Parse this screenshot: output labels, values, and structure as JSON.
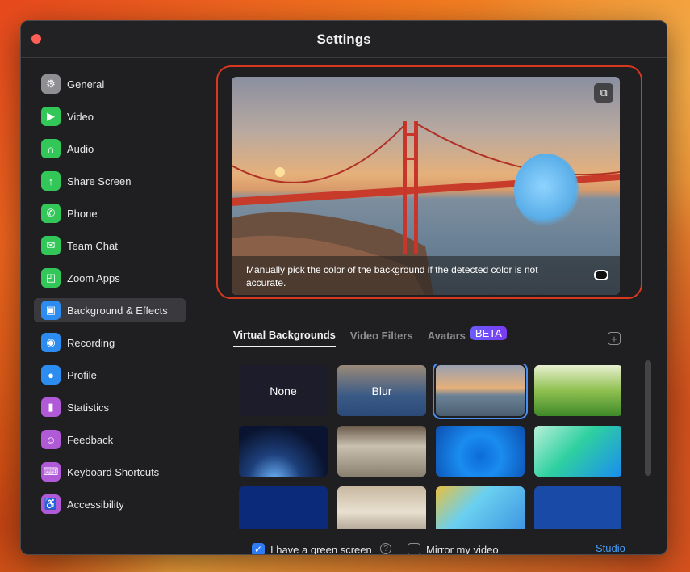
{
  "window": {
    "title": "Settings"
  },
  "sidebar": {
    "items": [
      {
        "label": "General",
        "icon": "gear-icon",
        "color": "#8e8e93",
        "glyph": "⚙"
      },
      {
        "label": "Video",
        "icon": "video-camera-icon",
        "color": "#33c759",
        "glyph": "▶"
      },
      {
        "label": "Audio",
        "icon": "headphones-icon",
        "color": "#33c759",
        "glyph": "∩"
      },
      {
        "label": "Share Screen",
        "icon": "share-screen-icon",
        "color": "#33c759",
        "glyph": "↑"
      },
      {
        "label": "Phone",
        "icon": "phone-icon",
        "color": "#33c759",
        "glyph": "✆"
      },
      {
        "label": "Team Chat",
        "icon": "chat-icon",
        "color": "#33c759",
        "glyph": "✉"
      },
      {
        "label": "Zoom Apps",
        "icon": "apps-icon",
        "color": "#33c759",
        "glyph": "◰"
      },
      {
        "label": "Background & Effects",
        "icon": "portrait-icon",
        "color": "#2d8cf0",
        "glyph": "▣",
        "active": true
      },
      {
        "label": "Recording",
        "icon": "record-icon",
        "color": "#2d8cf0",
        "glyph": "◉"
      },
      {
        "label": "Profile",
        "icon": "profile-icon",
        "color": "#2d8cf0",
        "glyph": "●"
      },
      {
        "label": "Statistics",
        "icon": "bar-chart-icon",
        "color": "#b05ad8",
        "glyph": "▮"
      },
      {
        "label": "Feedback",
        "icon": "smiley-icon",
        "color": "#b05ad8",
        "glyph": "☺"
      },
      {
        "label": "Keyboard Shortcuts",
        "icon": "keyboard-icon",
        "color": "#b05ad8",
        "glyph": "⌨"
      },
      {
        "label": "Accessibility",
        "icon": "accessibility-icon",
        "color": "#b05ad8",
        "glyph": "♿"
      }
    ]
  },
  "preview": {
    "caption": "Manually pick the color of the background if the detected color is not accurate."
  },
  "tabs": [
    {
      "label": "Virtual Backgrounds",
      "active": true
    },
    {
      "label": "Video Filters",
      "active": false
    },
    {
      "label": "Avatars",
      "active": false
    }
  ],
  "beta_badge": "BETA",
  "backgrounds": [
    {
      "label": "None",
      "bg": "#1c1c2a"
    },
    {
      "label": "Blur",
      "bg": "linear-gradient(180deg,#9a8a78 0%,#3a5a86 60%,#2b4a78 100%)"
    },
    {
      "label": "",
      "bg": "linear-gradient(180deg,#9aa0b0 0%,#e6b07a 45%,#6b8296 60%,#4a5e70 100%)",
      "selected": true
    },
    {
      "label": "",
      "bg": "linear-gradient(180deg,#e8f0d0 0%,#8fc050 50%,#3f8a2a 100%)"
    },
    {
      "label": "",
      "bg": "radial-gradient(ellipse at 40% 110%,#6fb8ff 0%,#1d3f7a 35%,#0a1430 70%)"
    },
    {
      "label": "",
      "bg": "linear-gradient(180deg,#6a5a4a 0%,#c9c0b0 40%,#8a8070 100%)"
    },
    {
      "label": "",
      "bg": "radial-gradient(circle at 50% 60%,#0c6cd8 0%,#1a8cf0 40%,#0b4fb0 100%)"
    },
    {
      "label": "",
      "bg": "linear-gradient(135deg,#b8f0d8 0%,#2fd0a0 45%,#1a8cf0 100%)"
    },
    {
      "label": "",
      "bg": "linear-gradient(180deg,#0b2a7a 0%,#0b2a7a 100%)"
    },
    {
      "label": "",
      "bg": "linear-gradient(180deg,#c8b8a0 0%,#e8e0d0 50%,#a09080 100%)"
    },
    {
      "label": "",
      "bg": "linear-gradient(135deg,#e8c040 0%,#6ad0f0 40%,#3a90e0 100%)"
    },
    {
      "label": "",
      "bg": "linear-gradient(180deg,#1a4aa8 0%,#1a4aa8 100%)"
    }
  ],
  "footer": {
    "green_screen_label": "I have a green screen",
    "green_screen_checked": true,
    "mirror_label": "Mirror my video",
    "mirror_checked": false,
    "studio_effects": "Studio Effects"
  }
}
